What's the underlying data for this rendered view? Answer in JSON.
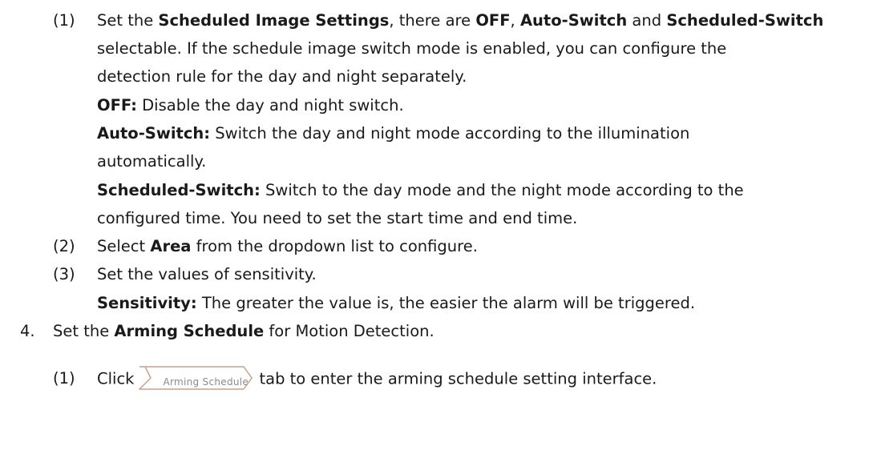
{
  "step1": {
    "num": "(1)",
    "l1_a": "Set the ",
    "l1_b": "Scheduled Image Settings",
    "l1_c": ", there are ",
    "l1_d": "OFF",
    "l1_e": ", ",
    "l1_f": "Auto-Switch",
    "l1_g": " and ",
    "l1_h": "Scheduled-Switch",
    "l2": "selectable. If the schedule image switch mode is enabled, you can configure the",
    "l3": "detection rule for the day and night separately.",
    "off_label": "OFF:",
    "off_text": " Disable the day and night switch.",
    "auto_label": "Auto-Switch:",
    "auto_text": " Switch the day and night mode according to the illumination",
    "auto_text2": "automatically.",
    "sched_label": "Scheduled-Switch:",
    "sched_text": " Switch to the day mode and the night mode according to the",
    "sched_text2": "configured time. You need to set the start time and end time."
  },
  "step2": {
    "num": "(2)",
    "a": "Select ",
    "b": "Area",
    "c": " from the dropdown list to configure."
  },
  "step3": {
    "num": "(3)",
    "a": "Set the values of sensitivity.",
    "sens_label": "Sensitivity:",
    "sens_text": " The greater the value is, the easier the alarm will be triggered."
  },
  "step4": {
    "num": "4.",
    "a": "Set the ",
    "b": "Arming Schedule",
    "c": " for Motion Detection."
  },
  "step4_1": {
    "num": "(1)",
    "a": "Click",
    "tab_label": "Arming Schedule",
    "c": "tab to enter the arming schedule setting interface."
  }
}
